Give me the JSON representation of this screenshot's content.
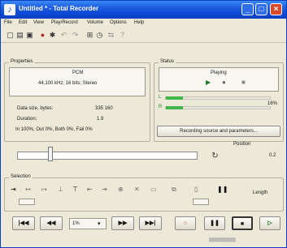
{
  "window": {
    "title": "Untitled * - Total Recorder",
    "min_glyph": "_",
    "max_glyph": "□",
    "close_glyph": "×"
  },
  "menu": [
    "File",
    "Edit",
    "View",
    "Play/Record",
    "Volume",
    "Options",
    "Help"
  ],
  "toolbar": {
    "icons": [
      "new-file-icon",
      "open-folder-icon",
      "save-icon",
      "record-source-icon",
      "settings-icon",
      "undo-icon",
      "redo-icon",
      "properties-icon",
      "schedule-icon",
      "split-icon",
      "help-icon"
    ]
  },
  "properties": {
    "label": "Properties",
    "format": "PCM",
    "params": "44,100 kHz; 16 bits; Stereo",
    "data_size_label": "Data size, bytes:",
    "data_size_value": "335 160",
    "duration_label": "Duration:",
    "duration_value": "1.9",
    "levels": "In 100%, Out   0%, Both   0%, Fail   0%"
  },
  "status": {
    "label": "Status",
    "state": "Playing",
    "left_channel": "L",
    "right_channel": "R",
    "meter_percent": "16%",
    "left_level": 0.16,
    "right_level": 0.16,
    "source_button": "Recording source and parameters..."
  },
  "position": {
    "label": "Position",
    "value": "0.2",
    "fraction": 0.17
  },
  "selection": {
    "label": "Selection",
    "length_label": "Length"
  },
  "transport": {
    "speed_value": "1%",
    "buttons": [
      "|◀◀",
      "◀◀",
      "▶▶",
      "▶▶|"
    ],
    "pause_glyph": "❚❚",
    "stop_glyph": "■"
  },
  "colors": {
    "titlebar": "#0c49d6",
    "meter": "#41b64a",
    "play": "#1b7a2c"
  }
}
